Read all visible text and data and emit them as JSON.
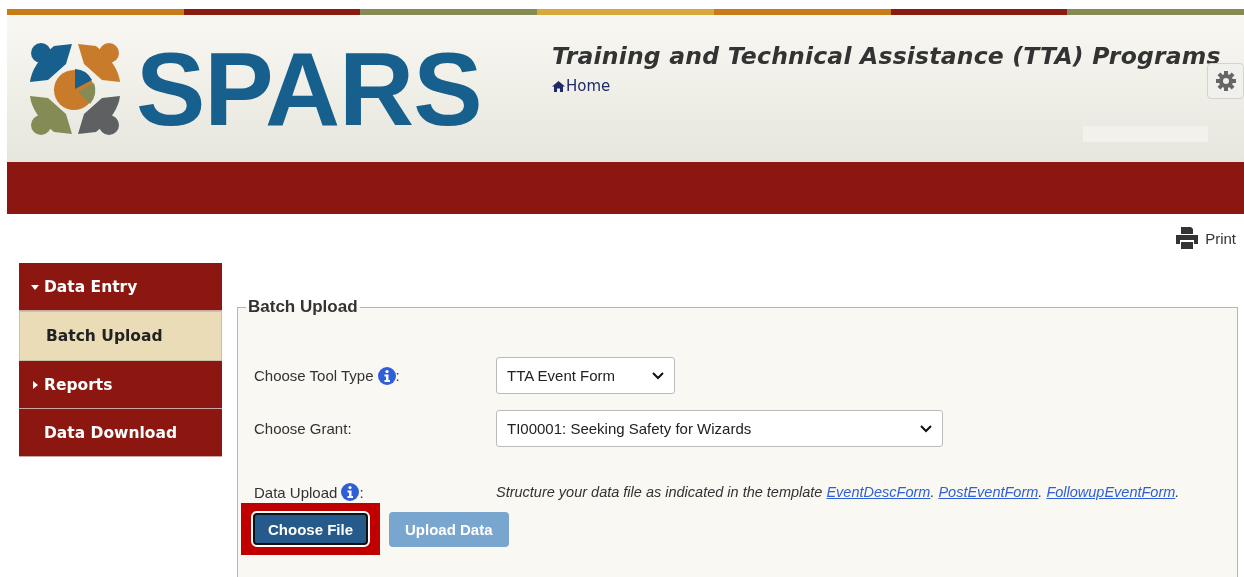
{
  "header": {
    "logo_text": "SPARS",
    "title": "Training and Technical Assistance (TTA) Programs",
    "home_link": "Home"
  },
  "print_link": "Print",
  "sidebar": {
    "items": [
      {
        "label": "Data Entry",
        "selected": false,
        "expanded": true,
        "children": [
          {
            "label": "Batch Upload",
            "selected": true
          }
        ]
      },
      {
        "label": "Reports",
        "selected": false,
        "expanded": false
      },
      {
        "label": "Data Download",
        "selected": false
      }
    ]
  },
  "form": {
    "legend": "Batch Upload",
    "tool_type": {
      "label": "Choose Tool Type",
      "suffix": ":",
      "value": "TTA Event Form"
    },
    "grant": {
      "label": "Choose Grant:",
      "value": "TI00001: Seeking Safety for Wizards"
    },
    "upload": {
      "label": "Data Upload",
      "suffix": ":",
      "instructions": "Structure your data file as indicated in the template",
      "links": [
        {
          "text": "EventDescForm",
          "suffix": "."
        },
        {
          "text": "PostEventForm",
          "suffix": "."
        },
        {
          "text": "FollowupEventForm",
          "suffix": "."
        }
      ]
    },
    "buttons": [
      {
        "label": "Choose File",
        "disabled": false,
        "highlighted": true
      },
      {
        "label": "Upload Data",
        "disabled": true,
        "highlighted": false
      }
    ]
  }
}
